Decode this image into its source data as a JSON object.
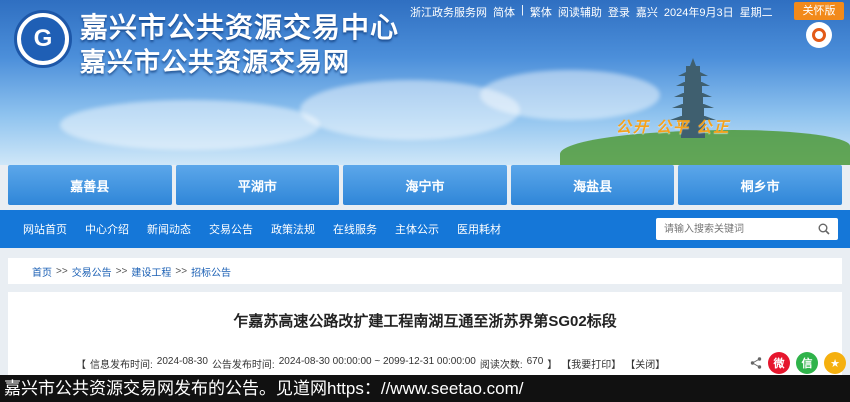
{
  "header": {
    "title_line1": "嘉兴市公共资源交易中心",
    "title_line2": "嘉兴市公共资源交易网",
    "top_links": [
      "浙江政务服务网",
      "简体",
      "|",
      "繁体",
      "阅读辅助",
      "登录",
      "嘉兴",
      "2024年9月3日",
      "星期二"
    ],
    "care_version": "关怀版",
    "slogan": "公开  公平  公正"
  },
  "cities": [
    "嘉善县",
    "平湖市",
    "海宁市",
    "海盐县",
    "桐乡市"
  ],
  "nav": {
    "items": [
      "网站首页",
      "中心介绍",
      "新闻动态",
      "交易公告",
      "政策法规",
      "在线服务",
      "主体公示",
      "医用耗材"
    ],
    "search_placeholder": "请输入搜索关键词"
  },
  "breadcrumb": [
    "首页",
    ">>",
    "交易公告",
    ">>",
    "建设工程",
    ">>",
    "招标公告"
  ],
  "article": {
    "title": "乍嘉苏高速公路改扩建工程南湖互通至浙苏界第SG02标段",
    "meta_open": "【",
    "publish_label": "信息发布时间:",
    "publish_time": "2024-08-30",
    "notice_period_label": "公告发布时间:",
    "notice_period": "2024-08-30 00:00:00 ~ 2099-12-31 00:00:00",
    "views_label": "阅读次数:",
    "views": "670",
    "meta_close": "】",
    "print_label": "【我要打印】",
    "close_label": "【关闭】"
  },
  "caption": "嘉兴市公共资源交易网发布的公告。见道网https：//www.seetao.com/",
  "colors": {
    "nav_blue": "#1577d8",
    "city_blue": "#2f86d8",
    "care_orange": "#f28a1b",
    "weibo_red": "#e6162d",
    "wechat_green": "#2fb34a",
    "qzone_yellow": "#f5b00f"
  },
  "icons": [
    "logo-emblem",
    "reader-icon",
    "search-icon",
    "share-icon",
    "weibo-icon",
    "wechat-icon",
    "qzone-icon"
  ]
}
